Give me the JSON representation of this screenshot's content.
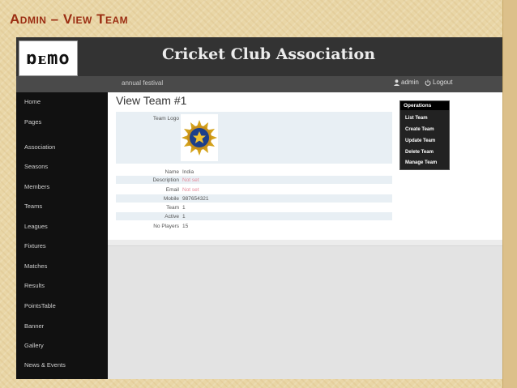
{
  "slide": {
    "title": "Admin – View Team"
  },
  "app": {
    "logo_text": "ɒᴇmo",
    "title": "Cricket Club Association",
    "tagline": "annual festival",
    "user": "admin",
    "logout": "Logout"
  },
  "sidebar": {
    "items": [
      {
        "label": "Home"
      },
      {
        "label": "Pages"
      },
      {
        "label": "Association"
      },
      {
        "label": "Seasons"
      },
      {
        "label": "Members"
      },
      {
        "label": "Teams"
      },
      {
        "label": "Leagues"
      },
      {
        "label": "Fixtures"
      },
      {
        "label": "Matches"
      },
      {
        "label": "Results"
      },
      {
        "label": "PointsTable"
      },
      {
        "label": "Banner"
      },
      {
        "label": "Gallery"
      },
      {
        "label": "News & Events"
      }
    ]
  },
  "main": {
    "heading": "View Team #1",
    "team_logo_label": "Team Logo",
    "fields": [
      {
        "label": "Name",
        "value": "India",
        "notset": false
      },
      {
        "label": "Description",
        "value": "Not set",
        "notset": true
      },
      {
        "label": "Email",
        "value": "Not set",
        "notset": true
      },
      {
        "label": "Mobile",
        "value": "987654321",
        "notset": false
      },
      {
        "label": "Team",
        "value": "1",
        "notset": false
      },
      {
        "label": "Active",
        "value": "1",
        "notset": false
      },
      {
        "label": "No Players",
        "value": "15",
        "notset": false
      }
    ]
  },
  "operations": {
    "title": "Operations",
    "items": [
      {
        "label": "List Team"
      },
      {
        "label": "Create Team"
      },
      {
        "label": "Update Team"
      },
      {
        "label": "Delete Team"
      },
      {
        "label": "Manage Team"
      }
    ]
  },
  "colors": {
    "slide_title": "#9b2d12",
    "header_bg": "#333333",
    "sidebar_bg": "#111111",
    "not_set": "#e58a9a",
    "row_stripe": "#e8eff4"
  },
  "icons": {
    "user": "user-icon",
    "logout": "power-icon",
    "team_logo": "bcci-crest-icon"
  }
}
